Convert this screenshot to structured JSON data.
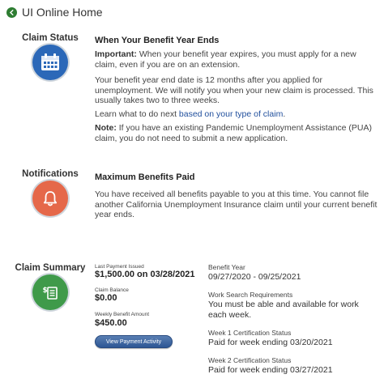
{
  "header": {
    "title": "UI Online Home"
  },
  "claim_status": {
    "section_title": "Claim Status",
    "heading": "When Your Benefit Year Ends",
    "important_label": "Important:",
    "important_text": " When your benefit year expires, you must apply for a new claim, even if you are on an extension.",
    "para2": "Your benefit year end date is 12 months after you applied for unemployment. We will notify you when your new claim is processed. This usually takes two to three weeks.",
    "learn_prefix": "Learn what to do next ",
    "learn_link": "based on your type of claim",
    "learn_suffix": ".",
    "note_label": "Note:",
    "note_text": " If you have an existing Pandemic Unemployment Assistance (PUA) claim, you do not need to submit a new application."
  },
  "notifications": {
    "section_title": "Notifications",
    "heading": "Maximum Benefits Paid",
    "body": "You have received all benefits payable to you at this time. You cannot file another California Unemployment Insurance claim until your current benefit year ends."
  },
  "claim_summary": {
    "section_title": "Claim Summary",
    "last_payment_label": "Last Payment Issued",
    "last_payment_value": "$1,500.00 on 03/28/2021",
    "claim_balance_label": "Claim Balance",
    "claim_balance_value": "$0.00",
    "weekly_benefit_label": "Weekly Benefit Amount",
    "weekly_benefit_value": "$450.00",
    "view_button": "View Payment Activity",
    "benefit_year_label": "Benefit Year",
    "benefit_year_value": "09/27/2020 - 09/25/2021",
    "work_search_label": "Work Search Requirements",
    "work_search_value": "You must be able and available for work each week.",
    "week1_label": "Week 1 Certification Status",
    "week1_value": "Paid for week ending 03/20/2021",
    "week2_label": "Week 2 Certification Status",
    "week2_value": "Paid for week ending 03/27/2021"
  },
  "icons": {
    "back": "chevron-left-icon",
    "calendar": "calendar-icon",
    "bell": "bell-icon",
    "dollar_document": "dollar-document-icon"
  },
  "colors": {
    "claim_status_icon": "#2b68b8",
    "notifications_icon": "#e5684a",
    "claim_summary_icon": "#3f9a4a",
    "link": "#1f4e9c",
    "button": "#3a629e"
  }
}
